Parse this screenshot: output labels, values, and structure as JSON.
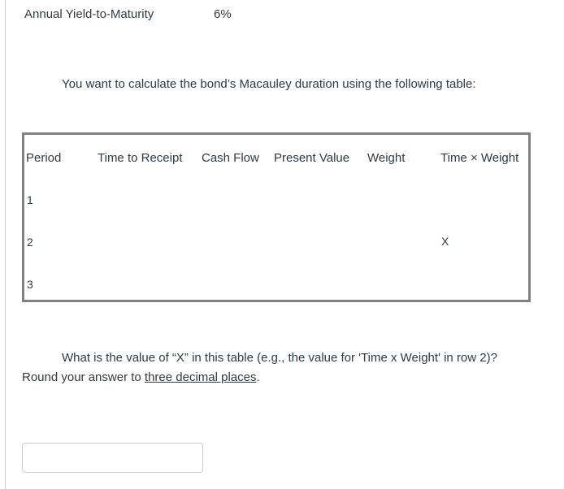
{
  "given": {
    "label": "Annual Yield-to-Maturity",
    "value": "6%"
  },
  "intro_text": "You want to calculate the bond’s Macauley duration using the following table:",
  "table": {
    "headers": [
      "Period",
      "Time to Receipt",
      "Cash Flow",
      "Present Value",
      "Weight",
      "Time × Weight"
    ],
    "rows": [
      {
        "period": "1",
        "time_x_weight": ""
      },
      {
        "period": "2",
        "time_x_weight": "X"
      },
      {
        "period": "3",
        "time_x_weight": ""
      }
    ]
  },
  "question": {
    "line1": "What is the value of “X” in this table (e.g., the value for 'Time x Weight' in row 2)?",
    "line2_prefix": "Round your answer to ",
    "line2_link": "three decimal places",
    "line2_suffix": "."
  },
  "answer": {
    "value": "",
    "placeholder": ""
  }
}
